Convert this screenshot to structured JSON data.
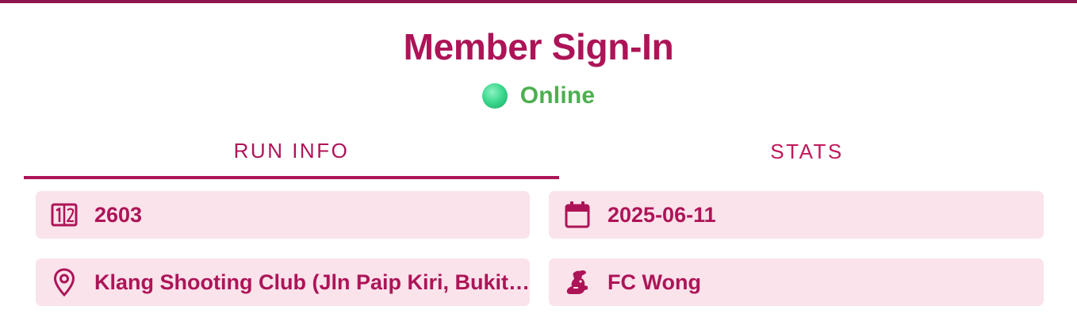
{
  "header": {
    "title": "Member Sign-In",
    "status": "Online",
    "status_icon": "status-dot-icon"
  },
  "tabs": [
    {
      "label": "RUN INFO",
      "active": true
    },
    {
      "label": "STATS",
      "active": false
    }
  ],
  "run_info": {
    "run_number": {
      "icon": "ticket-number-icon",
      "value": "2603"
    },
    "date": {
      "icon": "calendar-icon",
      "value": "2025-06-11"
    },
    "location": {
      "icon": "map-pin-icon",
      "value": "Klang Shooting Club (Jln Paip Kiri, Bukit …"
    },
    "hare": {
      "icon": "rabbit-icon",
      "value": "FC Wong"
    }
  },
  "colors": {
    "accent": "#ad1457",
    "top_bar": "#8e1650",
    "card_bg": "#fae3eb",
    "online": "#4caf50"
  }
}
